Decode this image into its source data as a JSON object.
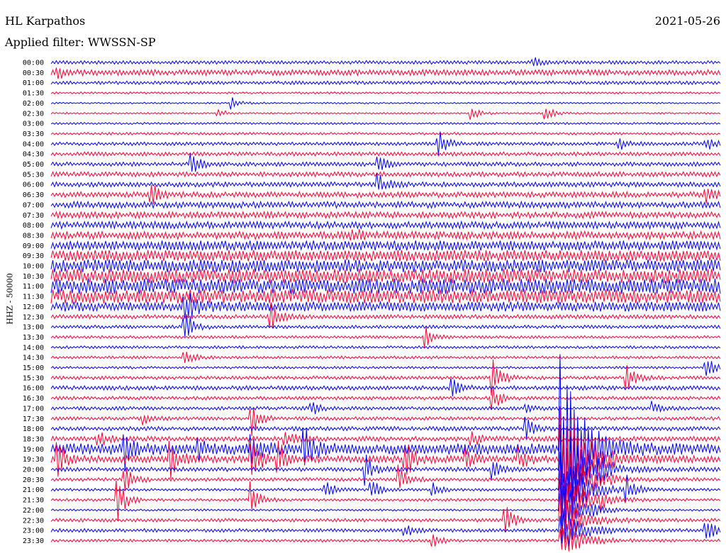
{
  "header": {
    "station": "HL Karpathos",
    "filter": "Applied filter: WWSSN-SP",
    "date": "2021-05-26"
  },
  "chart_data": {
    "type": "line",
    "title": "HL Karpathos",
    "subtitle": "Applied filter: WWSSN-SP",
    "date": "2021-05-26",
    "ylabel": "HHZ - 50000",
    "xlabel": "",
    "grid": false,
    "colors": {
      "even_row": "#0000ff",
      "odd_row": "#ff0033"
    },
    "row_labels": [
      "00:00",
      "00:30",
      "01:00",
      "01:30",
      "02:00",
      "02:30",
      "03:00",
      "03:30",
      "04:00",
      "04:30",
      "05:00",
      "05:30",
      "06:00",
      "06:30",
      "07:00",
      "07:30",
      "08:00",
      "08:30",
      "09:00",
      "09:30",
      "10:00",
      "10:30",
      "11:00",
      "11:30",
      "12:00",
      "12:30",
      "13:00",
      "13:30",
      "14:00",
      "14:30",
      "15:00",
      "15:30",
      "16:00",
      "16:30",
      "17:00",
      "17:30",
      "18:00",
      "18:30",
      "19:00",
      "19:30",
      "20:00",
      "20:30",
      "21:00",
      "21:30",
      "22:00",
      "22:30",
      "23:00",
      "23:30"
    ],
    "row_noise": [
      2.5,
      4,
      2.5,
      1.5,
      1.2,
      1.2,
      1.5,
      1.8,
      2.5,
      2.8,
      3,
      3.5,
      3.5,
      4,
      4.5,
      4.5,
      5,
      5.5,
      7,
      8,
      9,
      10,
      11,
      10,
      7,
      3,
      2.5,
      2,
      2,
      2,
      1.8,
      2.5,
      3,
      2.5,
      2.5,
      2.5,
      3,
      3.5,
      8,
      5,
      3,
      2.5,
      2,
      2,
      1.5,
      2.5,
      2.5,
      2
    ],
    "events": [
      {
        "row": 0,
        "x": 0.72,
        "amp": 8
      },
      {
        "row": 1,
        "x": 0.01,
        "amp": 10
      },
      {
        "row": 4,
        "x": 0.27,
        "amp": 8
      },
      {
        "row": 5,
        "x": 0.25,
        "amp": 6
      },
      {
        "row": 5,
        "x": 0.63,
        "amp": 8
      },
      {
        "row": 5,
        "x": 0.74,
        "amp": 10
      },
      {
        "row": 8,
        "x": 0.58,
        "amp": 18
      },
      {
        "row": 8,
        "x": 0.85,
        "amp": 8
      },
      {
        "row": 8,
        "x": 0.98,
        "amp": 8
      },
      {
        "row": 10,
        "x": 0.21,
        "amp": 14
      },
      {
        "row": 10,
        "x": 0.49,
        "amp": 10
      },
      {
        "row": 12,
        "x": 0.49,
        "amp": 14
      },
      {
        "row": 13,
        "x": 0.15,
        "amp": 16
      },
      {
        "row": 13,
        "x": 0.98,
        "amp": 10
      },
      {
        "row": 17,
        "x": 0.45,
        "amp": 10
      },
      {
        "row": 24,
        "x": 0.2,
        "amp": 25
      },
      {
        "row": 25,
        "x": 0.33,
        "amp": 20
      },
      {
        "row": 26,
        "x": 0.2,
        "amp": 25
      },
      {
        "row": 27,
        "x": 0.56,
        "amp": 14
      },
      {
        "row": 29,
        "x": 0.2,
        "amp": 12
      },
      {
        "row": 30,
        "x": 0.98,
        "amp": 14
      },
      {
        "row": 31,
        "x": 0.66,
        "amp": 30
      },
      {
        "row": 31,
        "x": 0.86,
        "amp": 25
      },
      {
        "row": 32,
        "x": 0.6,
        "amp": 12
      },
      {
        "row": 33,
        "x": 0.66,
        "amp": 20
      },
      {
        "row": 34,
        "x": 0.39,
        "amp": 10
      },
      {
        "row": 34,
        "x": 0.71,
        "amp": 8
      },
      {
        "row": 34,
        "x": 0.9,
        "amp": 8
      },
      {
        "row": 35,
        "x": 0.14,
        "amp": 10
      },
      {
        "row": 35,
        "x": 0.3,
        "amp": 25
      },
      {
        "row": 36,
        "x": 0.71,
        "amp": 14
      },
      {
        "row": 37,
        "x": 0.07,
        "amp": 15
      },
      {
        "row": 37,
        "x": 0.35,
        "amp": 15
      },
      {
        "row": 37,
        "x": 0.63,
        "amp": 10
      },
      {
        "row": 38,
        "x": 0.11,
        "amp": 25
      },
      {
        "row": 38,
        "x": 0.22,
        "amp": 12
      },
      {
        "row": 38,
        "x": 0.3,
        "amp": 22
      },
      {
        "row": 38,
        "x": 0.38,
        "amp": 28
      },
      {
        "row": 39,
        "x": 0.01,
        "amp": 30
      },
      {
        "row": 39,
        "x": 0.18,
        "amp": 25
      },
      {
        "row": 39,
        "x": 0.3,
        "amp": 30
      },
      {
        "row": 39,
        "x": 0.34,
        "amp": 25
      },
      {
        "row": 39,
        "x": 0.53,
        "amp": 28
      },
      {
        "row": 39,
        "x": 0.62,
        "amp": 16
      },
      {
        "row": 39,
        "x": 0.7,
        "amp": 16
      },
      {
        "row": 40,
        "x": 0.47,
        "amp": 20
      },
      {
        "row": 40,
        "x": 0.66,
        "amp": 14
      },
      {
        "row": 40,
        "x": 0.82,
        "amp": 10
      },
      {
        "row": 41,
        "x": 0.11,
        "amp": 30
      },
      {
        "row": 41,
        "x": 0.52,
        "amp": 22
      },
      {
        "row": 41,
        "x": 0.77,
        "amp": 10
      },
      {
        "row": 42,
        "x": 0.41,
        "amp": 14
      },
      {
        "row": 42,
        "x": 0.48,
        "amp": 16
      },
      {
        "row": 42,
        "x": 0.57,
        "amp": 10
      },
      {
        "row": 42,
        "x": 0.86,
        "amp": 20
      },
      {
        "row": 43,
        "x": 0.1,
        "amp": 30
      },
      {
        "row": 43,
        "x": 0.3,
        "amp": 25
      },
      {
        "row": 43,
        "x": 0.82,
        "amp": 8
      },
      {
        "row": 45,
        "x": 0.68,
        "amp": 20
      },
      {
        "row": 46,
        "x": 0.53,
        "amp": 8
      },
      {
        "row": 46,
        "x": 0.98,
        "amp": 14
      },
      {
        "row": 47,
        "x": 0.57,
        "amp": 10
      }
    ],
    "big_event": {
      "row": 38,
      "x": 0.76,
      "amp": 140
    }
  }
}
